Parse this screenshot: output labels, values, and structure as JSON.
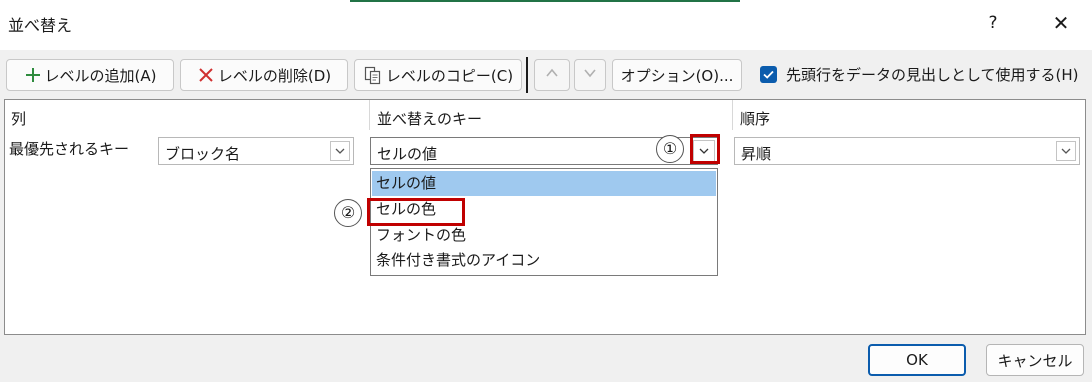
{
  "window": {
    "title": "並べ替え",
    "help_label": "?",
    "close_label": "✕"
  },
  "toolbar": {
    "add_level": "レベルの追加(A)",
    "delete_level": "レベルの削除(D)",
    "copy_level": "レベルのコピー(C)",
    "options": "オプション(O)...",
    "header_checkbox_label": "先頭行をデータの見出しとして使用する(H)",
    "header_checkbox_checked": true
  },
  "grid": {
    "headers": {
      "column": "列",
      "sort_on": "並べ替えのキー",
      "order": "順序"
    },
    "row": {
      "label": "最優先されるキー",
      "column_value": "ブロック名",
      "sort_on_value": "セルの値",
      "order_value": "昇順"
    },
    "dropdown_options": [
      "セルの値",
      "セルの色",
      "フォントの色",
      "条件付き書式のアイコン"
    ],
    "dropdown_selected_index": 0
  },
  "annotations": {
    "step1": "①",
    "step2": "②",
    "highlight_color": "#c00000"
  },
  "footer": {
    "ok_label": "OK",
    "cancel_label": "キャンセル"
  },
  "icons": {
    "add": "plus-icon",
    "delete": "x-icon",
    "copy": "copy-icon",
    "move_up": "chevron-up-icon",
    "move_down": "chevron-down-icon",
    "dropdown": "chevron-down-icon"
  },
  "colors": {
    "accent": "#0b5cad",
    "add_icon": "#2e8b3e",
    "delete_icon": "#d03030",
    "selection": "#9fc9ef"
  }
}
